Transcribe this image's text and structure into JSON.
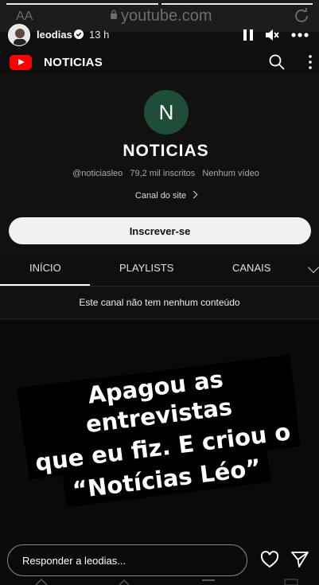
{
  "browser": {
    "aa_label": "AA",
    "url": "youtube.com"
  },
  "story": {
    "username": "leodias",
    "time_ago": "13 h",
    "progress_segments": 2,
    "caption_lines": [
      "Apagou as entrevistas",
      "que eu fiz. E criou o",
      "“Notícias Léo”"
    ],
    "reply_placeholder": "Responder a leodias..."
  },
  "youtube": {
    "header_title": "NOTICIAS",
    "channel": {
      "avatar_letter": "N",
      "name": "NOTICIAS",
      "handle": "@noticiasleo",
      "subscribers": "79,2 mil inscritos",
      "videos": "Nenhum vídeo",
      "site_link": "Canal do site",
      "subscribe_label": "Inscrever-se"
    },
    "tabs": [
      {
        "label": "INÍCIO",
        "active": true
      },
      {
        "label": "PLAYLISTS",
        "active": false
      },
      {
        "label": "CANAIS",
        "active": false
      }
    ],
    "empty_message": "Este canal não tem nenhum conteúdo"
  },
  "colors": {
    "youtube_red": "#ff0000",
    "channel_avatar": "#1f4d3a",
    "background": "#0f0f0f"
  }
}
